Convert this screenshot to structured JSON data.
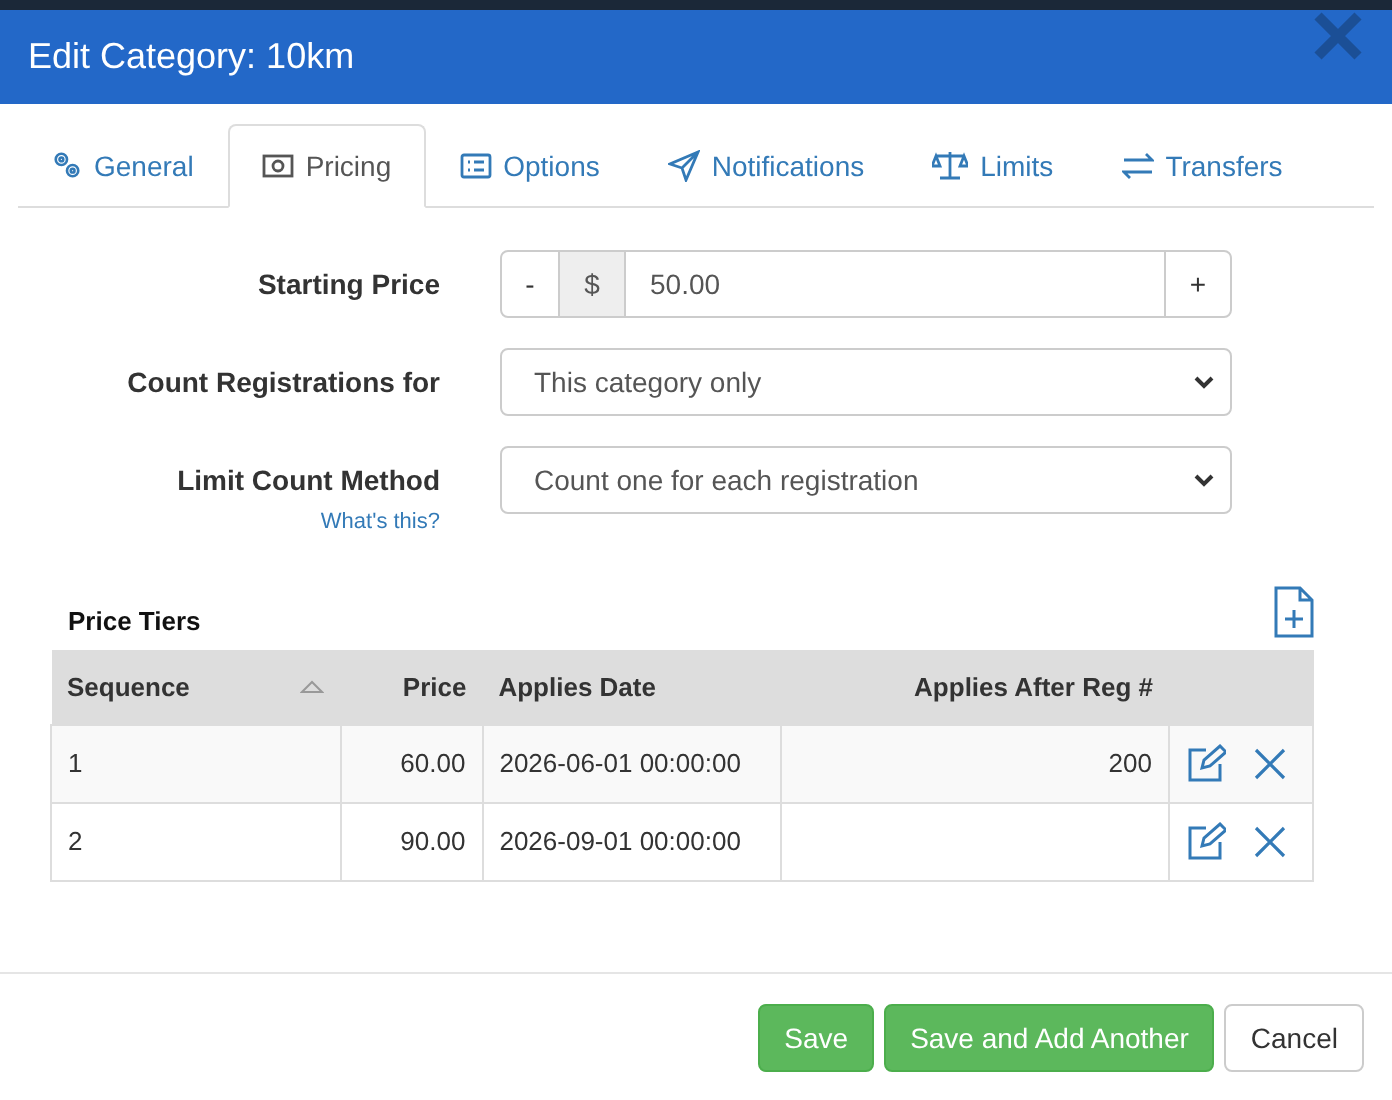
{
  "dialog": {
    "title": "Edit Category: 10km"
  },
  "tabs": [
    {
      "label": "General",
      "selected": false
    },
    {
      "label": "Pricing",
      "selected": true
    },
    {
      "label": "Options",
      "selected": false
    },
    {
      "label": "Notifications",
      "selected": false
    },
    {
      "label": "Limits",
      "selected": false
    },
    {
      "label": "Transfers",
      "selected": false
    }
  ],
  "form": {
    "starting_price": {
      "label": "Starting Price",
      "minus": "-",
      "currency": "$",
      "value": "50.00",
      "plus": "+"
    },
    "count_registrations": {
      "label": "Count Registrations for",
      "value": "This category only"
    },
    "limit_count_method": {
      "label": "Limit Count Method",
      "value": "Count one for each registration",
      "help_link": "What's this?"
    }
  },
  "price_tiers": {
    "title": "Price Tiers",
    "columns": [
      "Sequence",
      "Price",
      "Applies Date",
      "Applies After Reg #"
    ],
    "rows": [
      {
        "sequence": "1",
        "price": "60.00",
        "applies_date": "2026-06-01 00:00:00",
        "applies_after_reg": "200"
      },
      {
        "sequence": "2",
        "price": "90.00",
        "applies_date": "2026-09-01 00:00:00",
        "applies_after_reg": ""
      }
    ]
  },
  "buttons": [
    {
      "label": "Save",
      "kind": "primary"
    },
    {
      "label": "Save and Add Another",
      "kind": "primary"
    },
    {
      "label": "Cancel",
      "kind": "default"
    }
  ]
}
